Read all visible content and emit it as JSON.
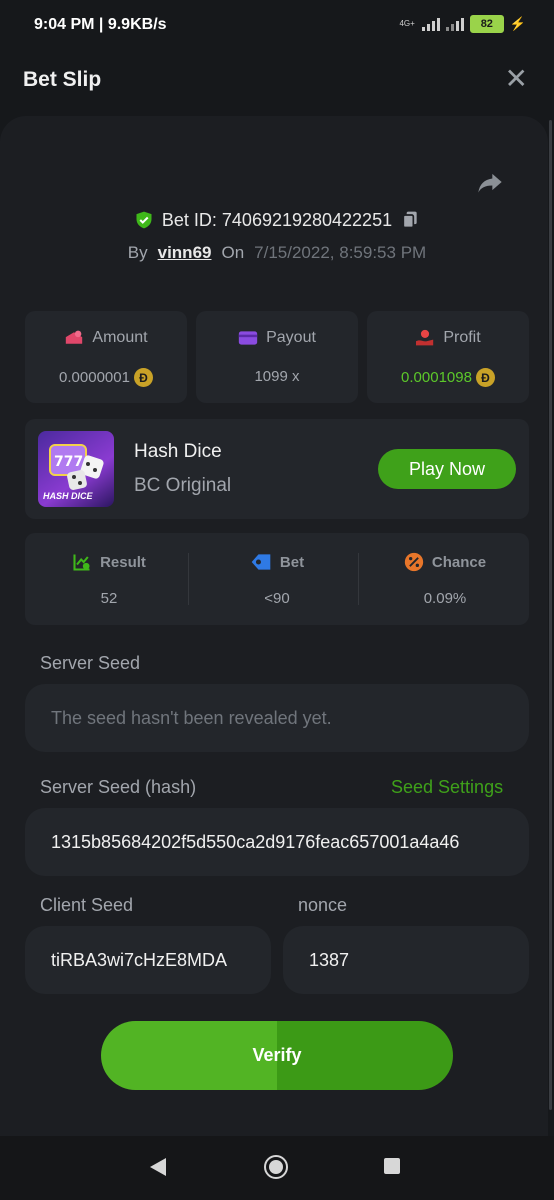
{
  "status_bar": {
    "time_speed": "9:04 PM | 9.9KB/s",
    "network": "4G+",
    "battery": "82"
  },
  "header": {
    "title": "Bet Slip"
  },
  "bet": {
    "id_label": "Bet ID: 74069219280422251",
    "by_label": "By",
    "username": "vinn69",
    "on_label": "On",
    "datetime": "7/15/2022, 8:59:53 PM"
  },
  "stats": {
    "amount_label": "Amount",
    "amount_value": "0.0000001",
    "payout_label": "Payout",
    "payout_value": "1099 x",
    "profit_label": "Profit",
    "profit_value": "0.0001098"
  },
  "coin_symbol": "Đ",
  "game": {
    "name": "Hash Dice",
    "subtitle": "BC Original",
    "thumb_text": "HASH DICE",
    "play_label": "Play Now"
  },
  "result": {
    "result_label": "Result",
    "result_value": "52",
    "bet_label": "Bet",
    "bet_value": "<90",
    "chance_label": "Chance",
    "chance_value": "0.09%"
  },
  "server_seed": {
    "label": "Server Seed",
    "placeholder": "The seed hasn't been revealed yet."
  },
  "server_seed_hash": {
    "label": "Server Seed (hash)",
    "value": "1315b85684202f5d550ca2d9176feac657001a4a46",
    "settings_link": "Seed Settings"
  },
  "client_seed": {
    "label": "Client Seed",
    "value": "tiRBA3wi7cHzE8MDA"
  },
  "nonce": {
    "label": "nonce",
    "value": "1387"
  },
  "verify_label": "Verify",
  "colors": {
    "accent_green": "#3fa11a",
    "profit_green": "#5cc82a",
    "background": "#16181b",
    "card": "#23262b"
  }
}
